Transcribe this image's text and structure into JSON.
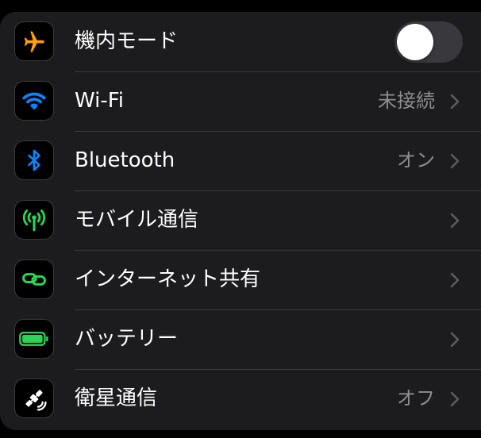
{
  "settings": {
    "rows": [
      {
        "id": "airplane",
        "icon": "airplane-icon",
        "label": "機内モード",
        "toggle": false
      },
      {
        "id": "wifi",
        "icon": "wifi-icon",
        "label": "Wi-Fi",
        "value": "未接続"
      },
      {
        "id": "bluetooth",
        "icon": "bluetooth-icon",
        "label": "Bluetooth",
        "value": "オン"
      },
      {
        "id": "cellular",
        "icon": "cellular-antenna-icon",
        "label": "モバイル通信",
        "value": ""
      },
      {
        "id": "hotspot",
        "icon": "personal-hotspot-link-icon",
        "label": "インターネット共有",
        "value": ""
      },
      {
        "id": "battery",
        "icon": "battery-icon",
        "label": "バッテリー",
        "value": ""
      },
      {
        "id": "satellite",
        "icon": "satellite-icon",
        "label": "衛星通信",
        "value": "オフ"
      }
    ]
  },
  "colors": {
    "orange": "#ff9f0a",
    "blue": "#0a84ff",
    "green": "#30d158",
    "white": "#ffffff",
    "secondary_text": "#8d8d92",
    "group_background": "#1c1c1e",
    "separator": "#3a3a3c"
  }
}
